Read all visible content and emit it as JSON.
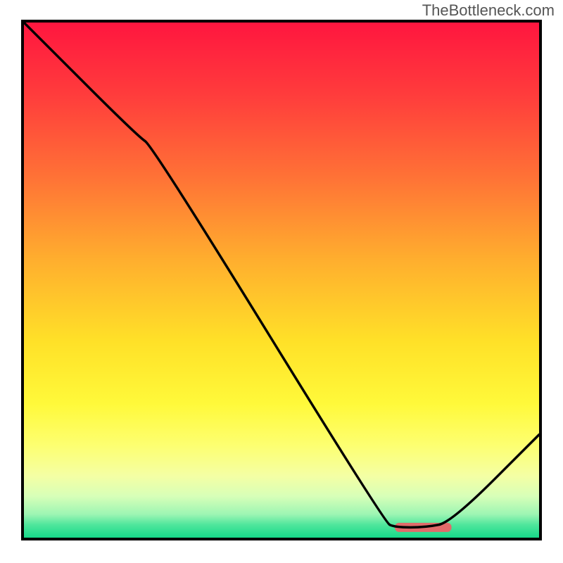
{
  "watermark": "TheBottleneck.com",
  "chart_data": {
    "type": "line",
    "title": "",
    "xlabel": "",
    "ylabel": "",
    "xlim": [
      0,
      100
    ],
    "ylim": [
      0,
      100
    ],
    "grid": false,
    "x": [
      0,
      22,
      25,
      70,
      72,
      78,
      83,
      100
    ],
    "values": [
      100,
      78,
      76,
      3,
      2,
      2,
      3,
      20
    ],
    "marker": {
      "x_start": 72,
      "x_end": 83,
      "y": 2,
      "color": "#e16a6a"
    },
    "gradient_stops": [
      {
        "offset": 0,
        "color": "#ff163f"
      },
      {
        "offset": 0.14,
        "color": "#ff3c3c"
      },
      {
        "offset": 0.3,
        "color": "#ff7236"
      },
      {
        "offset": 0.46,
        "color": "#ffae2e"
      },
      {
        "offset": 0.62,
        "color": "#ffe128"
      },
      {
        "offset": 0.74,
        "color": "#fff93a"
      },
      {
        "offset": 0.82,
        "color": "#fdff70"
      },
      {
        "offset": 0.88,
        "color": "#f4ffa4"
      },
      {
        "offset": 0.92,
        "color": "#d7ffb8"
      },
      {
        "offset": 0.955,
        "color": "#9cf5b3"
      },
      {
        "offset": 0.975,
        "color": "#4fe69c"
      },
      {
        "offset": 1.0,
        "color": "#16d98a"
      }
    ]
  }
}
